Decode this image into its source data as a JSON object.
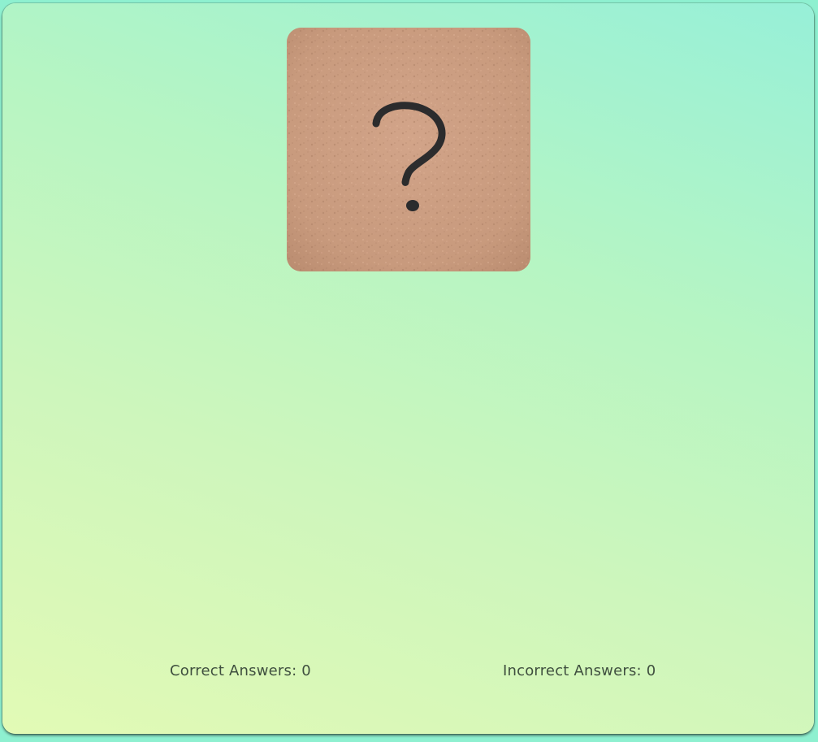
{
  "quiz": {
    "image_icon": "question-mark-icon",
    "image_bg_color": "#c89a7d"
  },
  "score": {
    "correct_label": "Correct Answers: ",
    "correct_value": "0",
    "incorrect_label": "Incorrect Answers: ",
    "incorrect_value": "0"
  }
}
